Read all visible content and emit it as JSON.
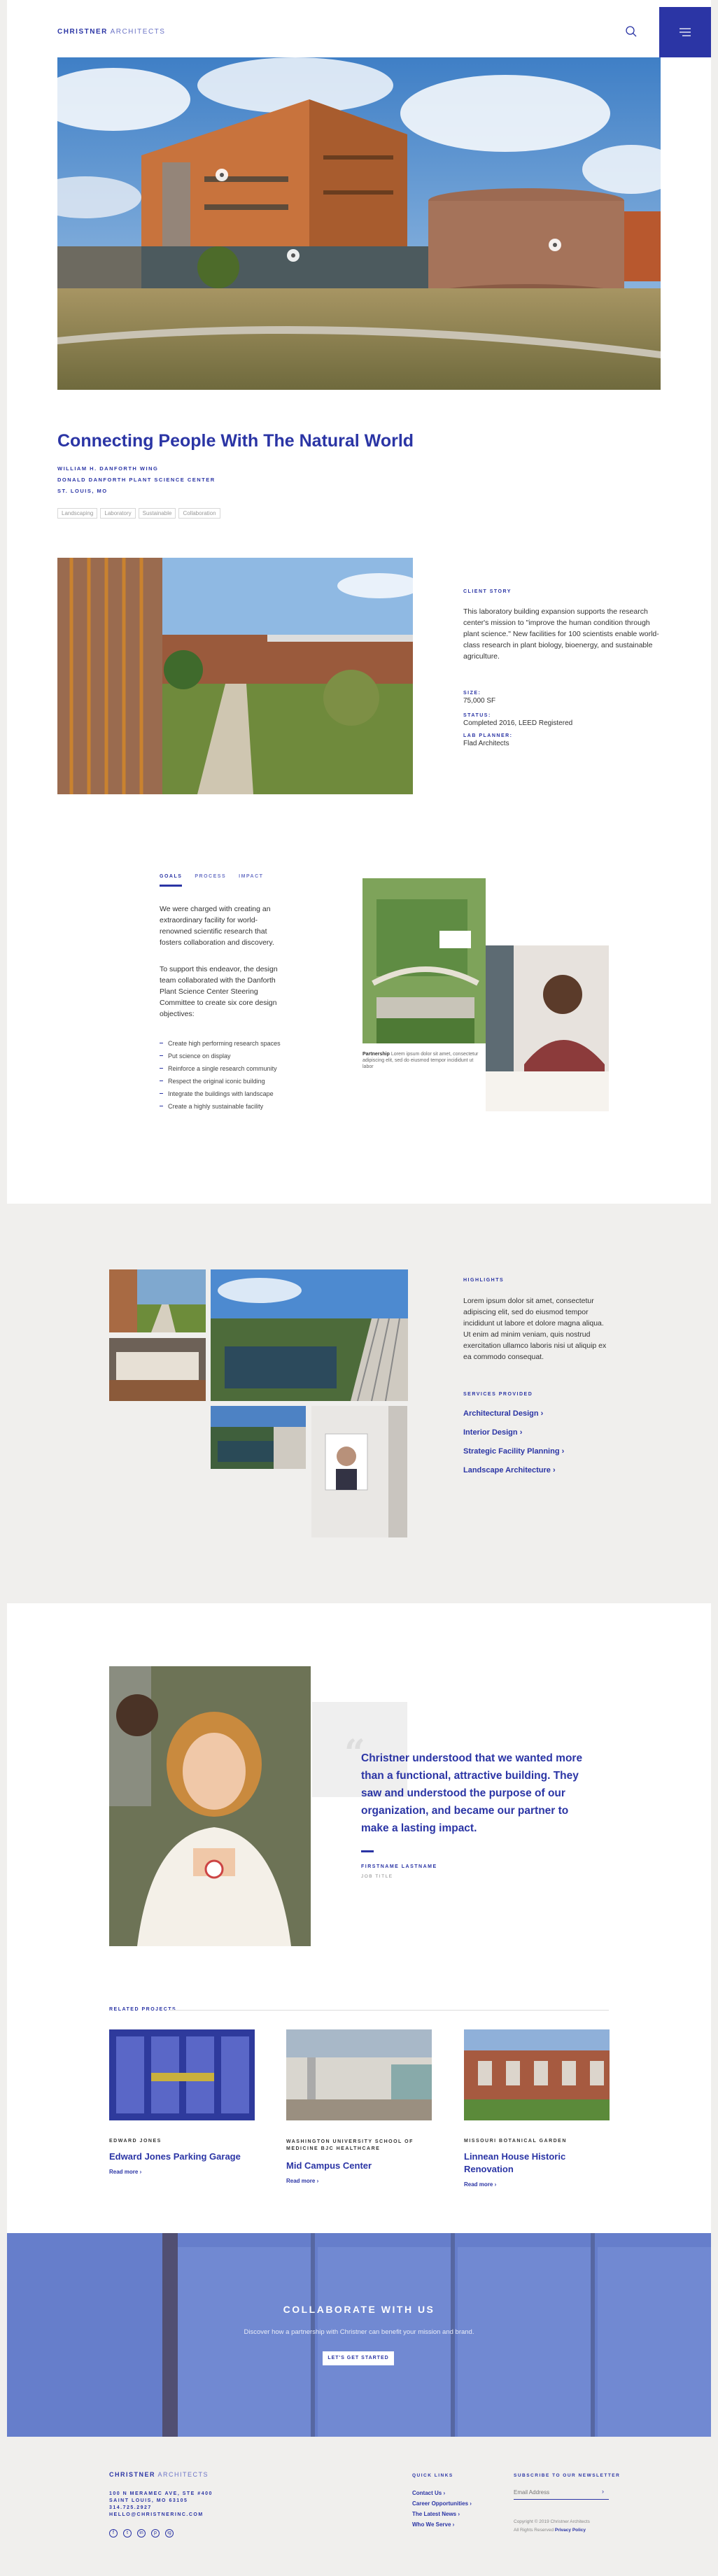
{
  "header": {
    "brand_bold": "CHRISTNER",
    "brand_light": " ARCHITECTS"
  },
  "hero": {
    "title": "Connecting People With The Natural World",
    "meta": [
      "WILLIAM H. DANFORTH WING",
      "DONALD DANFORTH PLANT SCIENCE CENTER",
      "ST. LOUIS, MO"
    ],
    "tags": [
      "Landscaping",
      "Laboratory",
      "Sustainable",
      "Collaboration"
    ]
  },
  "story": {
    "label": "CLIENT STORY",
    "text": "This laboratory building expansion supports the research center's mission to \"improve the human condition through plant science.\" New facilities for 100 scientists enable world-class research in plant biology, bioenergy, and sustainable agriculture.",
    "size_label": "SIZE:",
    "size_value": "75,000 SF",
    "status_label": "STATUS:",
    "status_value": "Completed 2016, LEED Registered",
    "planner_label": "LAB PLANNER:",
    "planner_value": "Flad Architects"
  },
  "goals": {
    "tabs": [
      "GOALS",
      "PROCESS",
      "IMPACT"
    ],
    "p1": "We were charged with creating an extraordinary facility for world-renowned scientific research that fosters collaboration and discovery.",
    "p2": "To support this endeavor, the design team collaborated with the Danforth Plant Science Center Steering Committee to create six core design objectives:",
    "list": [
      "Create high performing research spaces",
      "Put science on display",
      "Reinforce a single research community",
      "Respect the original iconic building",
      "Integrate the buildings with landscape",
      "Create a highly sustainable facility"
    ],
    "caption_bold": "Partnership",
    "caption": " Lorem ipsum dolor sit amet, consectetur adipiscing elit, sed do eiusmod tempor incididunt ut labor"
  },
  "highlights": {
    "label": "HIGHLIGHTS",
    "text": "Lorem ipsum dolor sit amet, consectetur adipiscing elit, sed do eiusmod tempor incididunt ut labore et dolore magna aliqua. Ut enim ad minim veniam, quis nostrud exercitation ullamco laboris nisi ut aliquip ex ea commodo consequat.",
    "services_label": "SERVICES PROVIDED",
    "services": [
      "Architectural Design",
      "Interior Design",
      "Strategic Facility Planning",
      "Landscape Architecture"
    ],
    "chevron": "›"
  },
  "quote": {
    "mark": "“",
    "text": "Christner understood that we wanted more than a functional, attractive building. They saw and understood the purpose of our organization, and became our partner to make a lasting impact.",
    "name": "FIRSTNAME LASTNAME",
    "title": "JOB TITLE"
  },
  "related": {
    "label": "RELATED PROJECTS",
    "items": [
      {
        "client": "EDWARD JONES",
        "title": "Edward Jones Parking Garage",
        "read": "Read more ›"
      },
      {
        "client": "WASHINGTON UNIVERSITY SCHOOL OF MEDICINE BJC HEALTHCARE",
        "title": "Mid Campus Center",
        "read": "Read more ›"
      },
      {
        "client": "MISSOURI BOTANICAL GARDEN",
        "title": "Linnean House Historic Renovation",
        "read": "Read more ›"
      }
    ]
  },
  "cta": {
    "title": "COLLABORATE WITH US",
    "text": "Discover how a partnership with Christner can benefit your mission and brand.",
    "button": "LET'S GET STARTED"
  },
  "footer": {
    "brand_bold": "CHRISTNER",
    "brand_light": " ARCHITECTS",
    "address": [
      "100 N MERAMEC AVE, STE #400",
      "SAINT LOUIS, MO 63105",
      "314.725.2927",
      "HELLO@CHRISTNERINC.COM"
    ],
    "quick_label": "QUICK LINKS",
    "quick": [
      "Contact Us ›",
      "Career Opportunities ›",
      "The Latest News ›",
      "Who We Serve ›"
    ],
    "newsletter_label": "SUBSCRIBE TO OUR NEWSLETTER",
    "email_placeholder": "Email Address",
    "copyright": "Copyright © 2019 Christner Architects",
    "rights": "All Rights Reserved ",
    "privacy": "Privacy Policy",
    "socials": [
      "f",
      "t",
      "in",
      "p",
      "ig"
    ]
  },
  "colors": {
    "accent": "#2b35a5",
    "page_bg": "#f0efed"
  }
}
